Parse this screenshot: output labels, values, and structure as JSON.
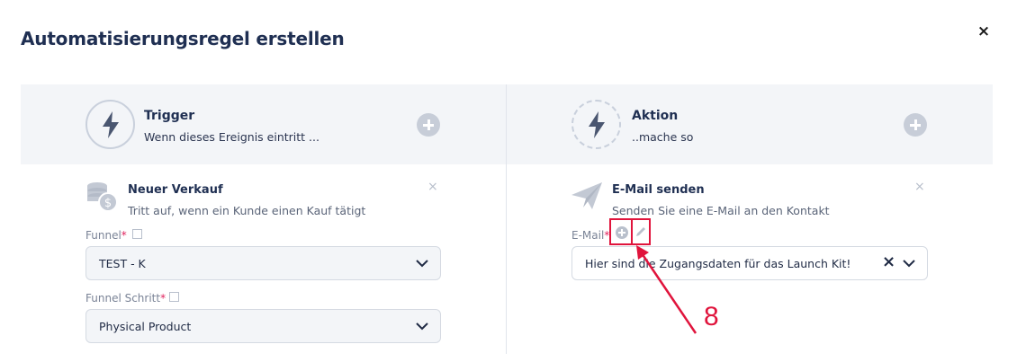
{
  "modal": {
    "title": "Automatisierungsregel erstellen",
    "close": "×"
  },
  "trigger": {
    "title": "Trigger",
    "subtitle": "Wenn dieses Ereignis eintritt ...",
    "card": {
      "title": "Neuer Verkauf",
      "description": "Tritt auf, wenn ein Kunde einen Kauf tätigt",
      "close": "×"
    },
    "fields": [
      {
        "label": "Funnel",
        "required": "*",
        "value": "TEST - K"
      },
      {
        "label": "Funnel Schritt",
        "required": "*",
        "value": "Physical Product"
      }
    ]
  },
  "action": {
    "title": "Aktion",
    "subtitle": "..mache so",
    "card": {
      "title": "E-Mail senden",
      "description": "Senden Sie eine E-Mail an den Kontakt",
      "close": "×"
    },
    "field": {
      "label": "E-Mail",
      "required": "*",
      "value": "Hier sind die Zugangsdaten für das Launch Kit!",
      "clear": "×"
    }
  },
  "annotation": {
    "number": "8",
    "color": "#e0143c"
  },
  "colors": {
    "accent": "#1f2f52",
    "required": "#e0245e",
    "panel_bg": "#f3f5f8"
  }
}
